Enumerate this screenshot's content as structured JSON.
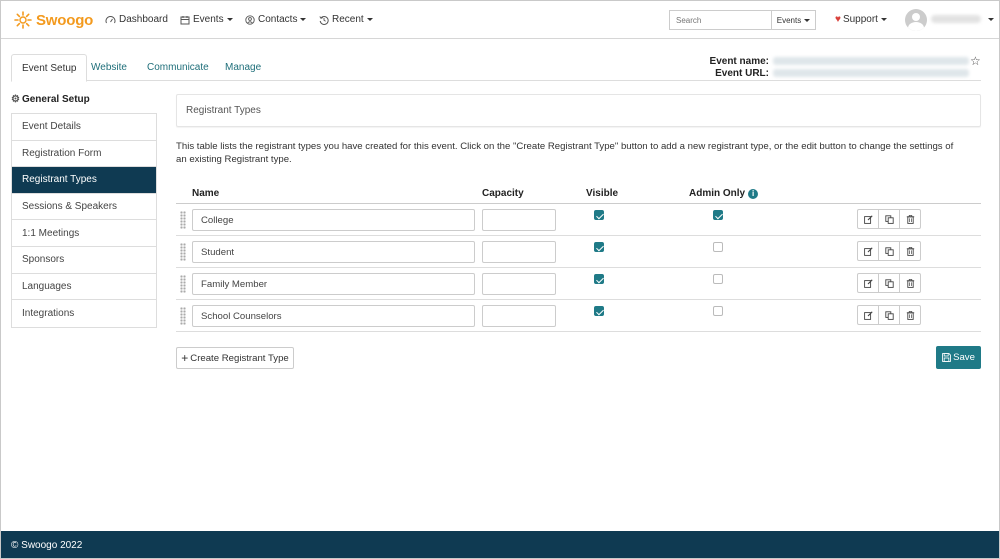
{
  "brand": {
    "name": "Swoogo",
    "accent": "#f39a1e"
  },
  "topnav": {
    "dashboard": "Dashboard",
    "events": "Events",
    "contacts": "Contacts",
    "recent": "Recent",
    "search_placeholder": "Search",
    "search_scope": "Events",
    "support": "Support"
  },
  "tabs": {
    "event_setup": "Event Setup",
    "website": "Website",
    "communicate": "Communicate",
    "manage": "Manage"
  },
  "event_meta": {
    "name_label": "Event name:",
    "url_label": "Event URL:"
  },
  "sidebar": {
    "title": "General Setup",
    "items": [
      {
        "label": "Event Details"
      },
      {
        "label": "Registration Form"
      },
      {
        "label": "Registrant Types"
      },
      {
        "label": "Sessions & Speakers"
      },
      {
        "label": "1:1 Meetings"
      },
      {
        "label": "Sponsors"
      },
      {
        "label": "Languages"
      },
      {
        "label": "Integrations"
      }
    ],
    "active_index": 2,
    "active_color": "#0f3a52"
  },
  "main": {
    "panel_title": "Registrant Types",
    "description": "This table lists the registrant types you have created for this event. Click on the \"Create Registrant Type\" button to add a new registrant type, or the edit button to change the settings of an existing Registrant type.",
    "columns": {
      "name": "Name",
      "capacity": "Capacity",
      "visible": "Visible",
      "admin_only": "Admin Only"
    },
    "rows": [
      {
        "name": "College",
        "capacity": "",
        "visible": true,
        "admin_only": true
      },
      {
        "name": "Student",
        "capacity": "",
        "visible": true,
        "admin_only": false
      },
      {
        "name": "Family Member",
        "capacity": "",
        "visible": true,
        "admin_only": false
      },
      {
        "name": "School Counselors",
        "capacity": "",
        "visible": true,
        "admin_only": false
      }
    ],
    "create_button": "Create Registrant Type",
    "save_button": "Save",
    "primary_color": "#1f7a87"
  },
  "footer": {
    "copyright": "© Swoogo 2022"
  }
}
